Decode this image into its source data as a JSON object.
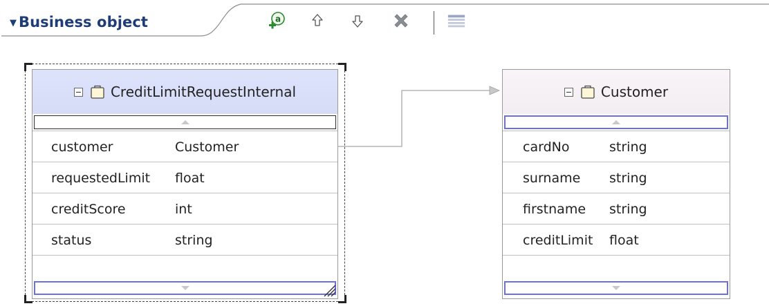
{
  "header": {
    "title": "Business object",
    "toolbar": [
      {
        "name": "add-attribute-icon",
        "tooltip": ""
      },
      {
        "name": "move-up-icon",
        "tooltip": ""
      },
      {
        "name": "move-down-icon",
        "tooltip": ""
      },
      {
        "name": "delete-icon",
        "tooltip": ""
      },
      {
        "name": "layout-icon",
        "tooltip": ""
      }
    ],
    "colors": {
      "title": "#1e3c75",
      "add_icon_green": "#2c8a2c",
      "delete_gray": "#8a8f96"
    }
  },
  "objects": [
    {
      "name": "CreditLimitRequestInternal",
      "selected": true,
      "fields": [
        {
          "name": "customer",
          "type": "Customer"
        },
        {
          "name": "requestedLimit",
          "type": "float"
        },
        {
          "name": "creditScore",
          "type": "int"
        },
        {
          "name": "status",
          "type": "string"
        }
      ]
    },
    {
      "name": "Customer",
      "selected": false,
      "fields": [
        {
          "name": "cardNo",
          "type": "string"
        },
        {
          "name": "surname",
          "type": "string"
        },
        {
          "name": "firstname",
          "type": "string"
        },
        {
          "name": "creditLimit",
          "type": "float"
        }
      ]
    }
  ],
  "relationship": {
    "from_field": "customer",
    "to_object": "Customer"
  },
  "colors": {
    "selected_header": "#d9dff8",
    "plain_header": "#f4f0f4",
    "scroll_border": "#6b6fe0",
    "connector": "#a8a8a8"
  }
}
